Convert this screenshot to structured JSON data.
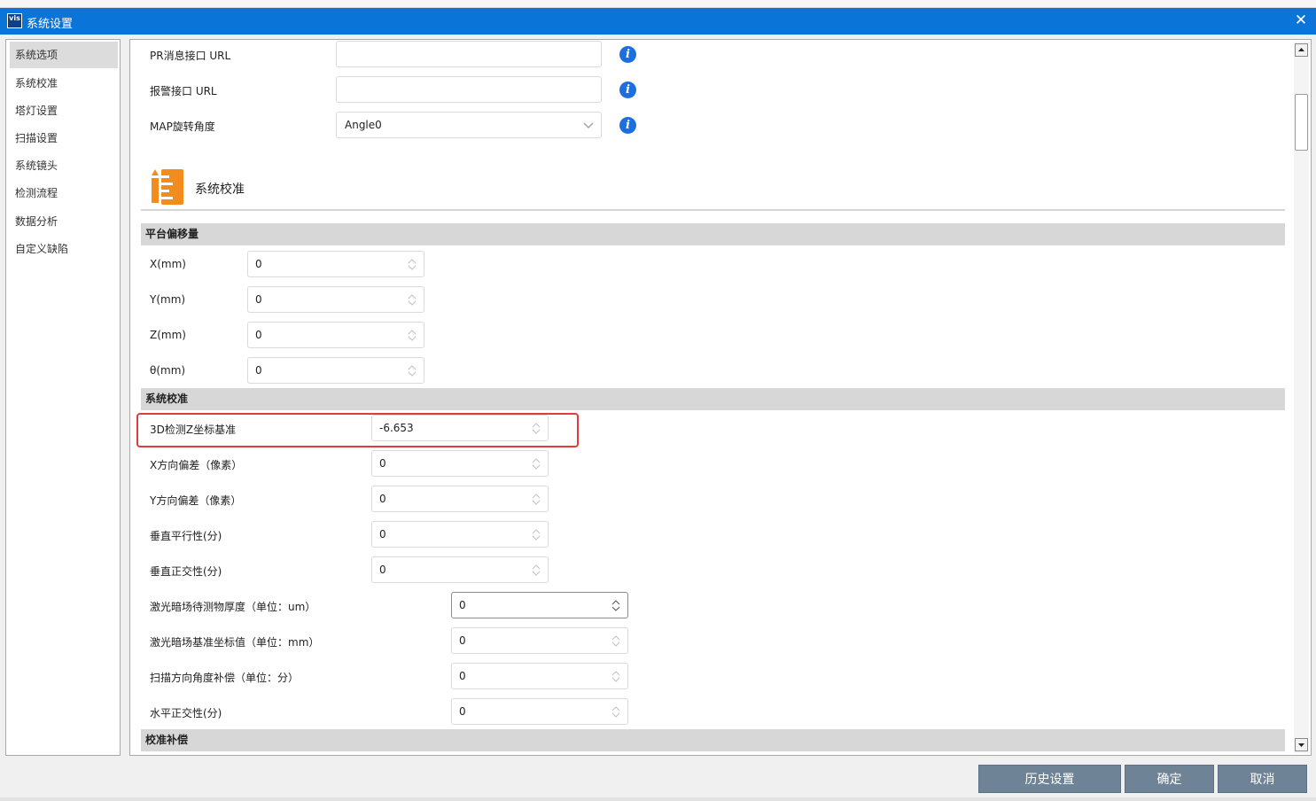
{
  "window": {
    "title": "系统设置",
    "app_badge": "vis"
  },
  "sidebar": {
    "items": [
      {
        "label": "系统选项",
        "active": true
      },
      {
        "label": "系统校准"
      },
      {
        "label": "塔灯设置"
      },
      {
        "label": "扫描设置"
      },
      {
        "label": "系统镜头"
      },
      {
        "label": "检测流程"
      },
      {
        "label": "数据分析"
      },
      {
        "label": "自定义缺陷"
      }
    ]
  },
  "options": {
    "pr_url_label": "PR消息接口 URL",
    "pr_url_value": "",
    "alarm_url_label": "报警接口 URL",
    "alarm_url_value": "",
    "map_rotation_label": "MAP旋转角度",
    "map_rotation_value": "Angle0"
  },
  "calibration": {
    "section_title": "系统校准",
    "platform_offset_header": "平台偏移量",
    "offsets": [
      {
        "label": "X(mm)",
        "value": "0"
      },
      {
        "label": "Y(mm)",
        "value": "0"
      },
      {
        "label": "Z(mm)",
        "value": "0"
      },
      {
        "label": "θ(mm)",
        "value": "0"
      }
    ],
    "system_calib_header": "系统校准",
    "calib_a": [
      {
        "label": "3D检测Z坐标基准",
        "value": "-6.653"
      },
      {
        "label": "X方向偏差（像素）",
        "value": "0"
      },
      {
        "label": "Y方向偏差（像素）",
        "value": "0"
      },
      {
        "label": "垂直平行性(分)",
        "value": "0"
      },
      {
        "label": "垂直正交性(分)",
        "value": "0"
      }
    ],
    "calib_b": [
      {
        "label": "激光暗场待测物厚度（单位：um）",
        "value": "0"
      },
      {
        "label": "激光暗场基准坐标值（单位：mm）",
        "value": "0"
      },
      {
        "label": "扫描方向角度补偿（单位：分）",
        "value": "0"
      },
      {
        "label": "水平正交性(分)",
        "value": "0"
      }
    ],
    "compensation_header": "校准补偿"
  },
  "footer": {
    "history_label": "历史设置",
    "ok_label": "确定",
    "cancel_label": "取消"
  },
  "colors": {
    "titlebar": "#0a74d8",
    "accent_icon": "#f28c1c",
    "info_icon": "#1e6fde",
    "highlight": "#e23b3b",
    "footer_button": "#6e8396"
  }
}
